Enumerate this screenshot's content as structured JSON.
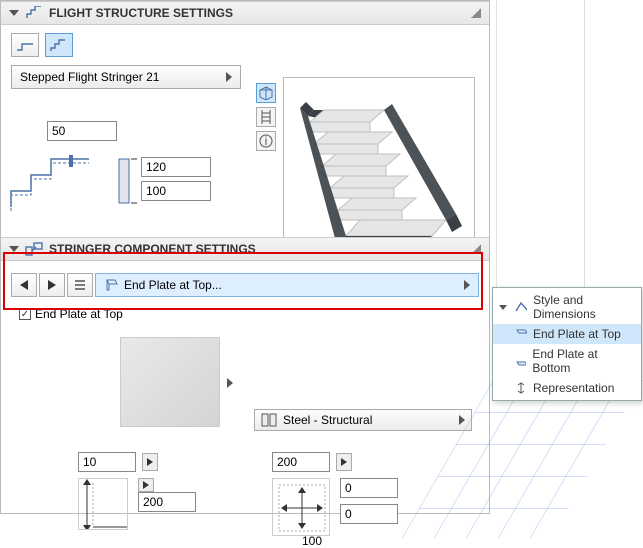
{
  "sections": {
    "flight": {
      "title": "FLIGHT STRUCTURE SETTINGS"
    },
    "stringer": {
      "title": "STRINGER COMPONENT SETTINGS"
    }
  },
  "flight": {
    "stringer_type": "Stepped Flight Stringer 21",
    "offset": "50",
    "height1": "120",
    "height2": "100"
  },
  "component": {
    "selected": "End Plate at Top...",
    "checkbox_label": "End Plate at Top",
    "material": "Steel - Structural"
  },
  "dims": {
    "left_v": "10",
    "left_h": "200",
    "right_v": "200",
    "right_o1": "0",
    "right_o2": "0",
    "right_bottom": "100"
  },
  "popup": {
    "group": "Style and Dimensions",
    "i1": "End Plate at Top",
    "i2": "End Plate at Bottom",
    "i3": "Representation"
  },
  "icons": {
    "cube": "◇",
    "ladder": "▦",
    "info": "ⓘ"
  }
}
